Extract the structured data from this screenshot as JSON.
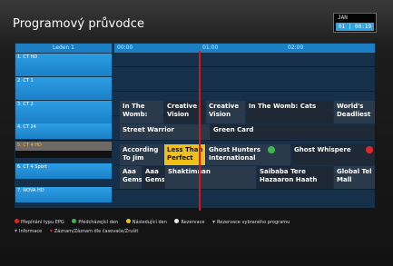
{
  "title": "Programový průvodce",
  "clock": {
    "date": "JAN",
    "time": "01 | 00:19"
  },
  "timeline": {
    "day": "Leden 1",
    "slots": [
      "00:00",
      "01:00",
      "02:00"
    ]
  },
  "channels": [
    {
      "label": "1. CT HD"
    },
    {
      "label": "2. CT 1"
    },
    {
      "label": "3. CT 2"
    },
    {
      "label": "4. CT 24"
    },
    {
      "label": "5. CT 4 HD"
    },
    {
      "label": "6. CT 4 Sport"
    },
    {
      "label": "7. NOVA HD"
    }
  ],
  "events": {
    "row3": [
      {
        "title": "In The Womb:"
      },
      {
        "title": "Creative Vision"
      },
      {
        "title": "Creative Vision"
      },
      {
        "title": "In The Womb: Cats"
      },
      {
        "title": "World's Deadliest"
      }
    ],
    "row3b": [
      {
        "title": "Street Warrior"
      },
      {
        "title": "Green Card"
      }
    ],
    "row4": [
      {
        "title": "According To Jim"
      },
      {
        "title": "Less Than Perfect"
      },
      {
        "title": "Ghost Hunters International"
      },
      {
        "title": "Ghost Whispere"
      }
    ],
    "row5": [
      {
        "title": "Aaa Gems"
      },
      {
        "title": "Aaa Gems"
      },
      {
        "title": "Shaktimaan"
      },
      {
        "title": "Saibaba Tere Hazaaron Haath"
      },
      {
        "title": "Global Tel Mall"
      }
    ]
  },
  "footer": {
    "line1": [
      {
        "label": "Přepínání typu EPG",
        "icon": "red-button"
      },
      {
        "label": "Předcházející den",
        "icon": "green-button"
      },
      {
        "label": "Následující den",
        "icon": "yellow-button"
      },
      {
        "label": "Rezervace",
        "icon": "white-button"
      },
      {
        "label": "Rezervace vybraného programu",
        "icon": "record-button"
      }
    ],
    "line2": [
      {
        "label": "Informace",
        "icon": "info-button"
      },
      {
        "label": "Záznam/Záznam dle časovače/Zrušit",
        "icon": "record-timer-button"
      }
    ]
  },
  "colors": {
    "accent": "#1d7fc4",
    "highlight": "#f0c018",
    "now_line": "#d21818"
  }
}
